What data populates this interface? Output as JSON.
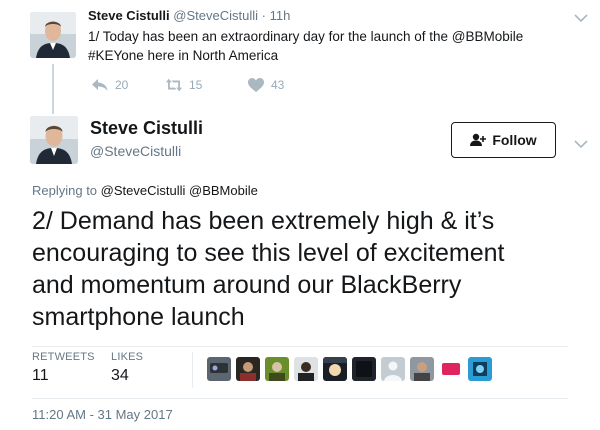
{
  "parent_tweet": {
    "name": "Steve Cistulli",
    "handle": "@SteveCistulli",
    "separator": "·",
    "time": "11h",
    "text_lines": [
      "1/ Today has been an extraordinary day for the launch of the @BBMobile",
      "#KEYone here in North America"
    ],
    "actions": {
      "reply_count": "20",
      "retweet_count": "15",
      "like_count": "43"
    }
  },
  "main_tweet": {
    "name": "Steve Cistulli",
    "handle": "@SteveCistulli",
    "follow_label": "Follow",
    "replying_prefix": "Replying to",
    "replying_mentions": "@SteveCistulli @BBMobile",
    "text_lines": [
      "2/ Demand has been extremely high & it’s",
      "encouraging to see this level of excitement",
      "and momentum around our BlackBerry",
      "smartphone launch"
    ],
    "stats": {
      "retweets_label": "RETWEETS",
      "retweets_value": "11",
      "likes_label": "LIKES",
      "likes_value": "34"
    },
    "timestamp": "11:20 AM - 31 May 2017"
  },
  "icons": {
    "reply": "reply-icon",
    "retweet": "retweet-icon",
    "like": "heart-icon",
    "follow": "add-user-icon",
    "menu": "chevron-down-icon"
  },
  "colors": {
    "text": "#14171a",
    "secondary_text": "#657786",
    "action_icon": "#aab8c2",
    "divider": "#e6ecf0"
  }
}
